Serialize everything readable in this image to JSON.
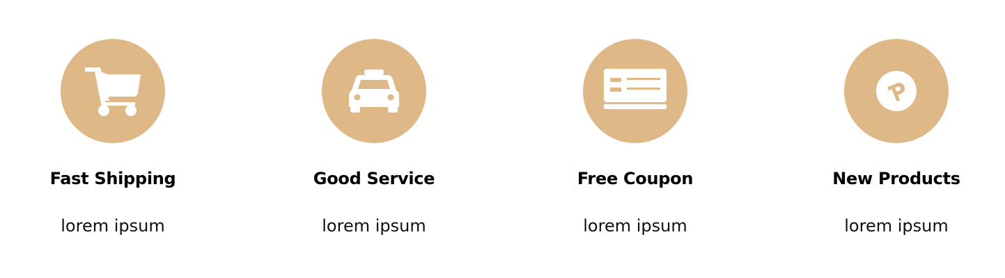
{
  "colors": {
    "accent": "#DFB887",
    "icon": "#FFFFFF",
    "title": "#000000",
    "text": "#111111"
  },
  "features": [
    {
      "icon": "shopping-cart-icon",
      "title": "Fast Shipping",
      "description": "lorem ipsum"
    },
    {
      "icon": "taxi-icon",
      "title": "Good Service",
      "description": "lorem ipsum"
    },
    {
      "icon": "credit-card-icon",
      "title": "Free Coupon",
      "description": "lorem ipsum"
    },
    {
      "icon": "product-hunt-icon",
      "title": "New Products",
      "description": "lorem ipsum"
    }
  ]
}
